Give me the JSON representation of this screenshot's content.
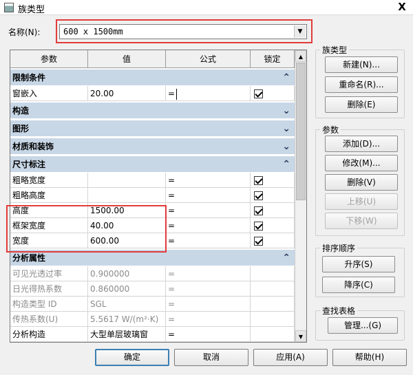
{
  "window": {
    "title": "族类型",
    "close_glyph": "X"
  },
  "name": {
    "label": "名称(N):",
    "value": "600 x 1500mm"
  },
  "grid": {
    "headers": [
      "参数",
      "值",
      "公式",
      "锁定"
    ],
    "groups": [
      {
        "title": "限制条件",
        "chevron": "up",
        "rows": [
          {
            "param": "窗嵌入",
            "value": "20.00",
            "formula": "=",
            "locked": true,
            "gray": false,
            "caret": true
          }
        ]
      },
      {
        "title": "构造",
        "chevron": "down",
        "rows": []
      },
      {
        "title": "图形",
        "chevron": "down",
        "rows": []
      },
      {
        "title": "材质和装饰",
        "chevron": "down",
        "rows": []
      },
      {
        "title": "尺寸标注",
        "chevron": "up",
        "rows": [
          {
            "param": "粗略宽度",
            "value": "",
            "formula": "=",
            "locked": true,
            "gray": false
          },
          {
            "param": "粗略高度",
            "value": "",
            "formula": "=",
            "locked": true,
            "gray": false
          },
          {
            "param": "高度",
            "value": "1500.00",
            "formula": "=",
            "locked": true,
            "gray": false
          },
          {
            "param": "框架宽度",
            "value": "40.00",
            "formula": "=",
            "locked": true,
            "gray": false
          },
          {
            "param": "宽度",
            "value": "600.00",
            "formula": "=",
            "locked": true,
            "gray": false
          }
        ]
      },
      {
        "title": "分析属性",
        "chevron": "up",
        "rows": [
          {
            "param": "可见光透过率",
            "value": "0.900000",
            "formula": "=",
            "locked": false,
            "gray": true
          },
          {
            "param": "日光得热系数",
            "value": "0.860000",
            "formula": "=",
            "locked": false,
            "gray": true
          },
          {
            "param": "构造类型 ID",
            "value": "SGL",
            "formula": "=",
            "locked": false,
            "gray": true
          },
          {
            "param": "传热系数(U)",
            "value": "5.5617 W/(m²·K)",
            "formula": "=",
            "locked": false,
            "gray": true
          },
          {
            "param": "分析构造",
            "value": "大型单层玻璃窗",
            "formula": "=",
            "locked": false,
            "gray": false
          }
        ]
      }
    ]
  },
  "family_types": {
    "legend": "族类型",
    "new": "新建(N)...",
    "rename": "重命名(R)...",
    "delete": "删除(E)"
  },
  "parameters": {
    "legend": "参数",
    "add": "添加(D)...",
    "modify": "修改(M)...",
    "delete": "删除(V)",
    "move_up": "上移(U)",
    "move_down": "下移(W)"
  },
  "sort": {
    "legend": "排序顺序",
    "ascending": "升序(S)",
    "descending": "降序(C)"
  },
  "lookup": {
    "legend": "查找表格",
    "manage": "管理...(G)"
  },
  "footer": {
    "ok": "确定",
    "cancel": "取消",
    "apply": "应用(A)",
    "help": "帮助(H)"
  },
  "colors": {
    "highlight": "#e23b3b",
    "group_bg": "#c8d7e6"
  }
}
